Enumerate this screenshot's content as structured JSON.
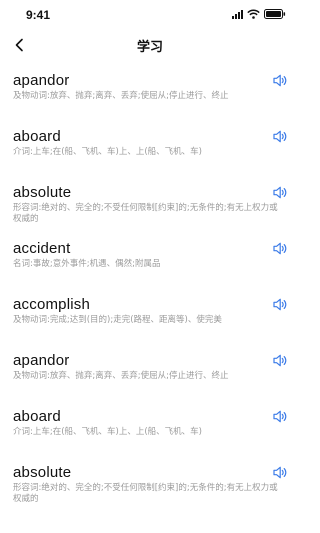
{
  "status_bar": {
    "time": "9:41"
  },
  "header": {
    "title": "学习"
  },
  "colors": {
    "accent": "#3b7be8",
    "definition": "#9b9b9b"
  },
  "words": [
    {
      "word": "apandor",
      "definition": "及物动词:放弃、抛弃;离弃、丢弃;使屈从;停止进行、终止"
    },
    {
      "word": "aboard",
      "definition": "介词:上车;在(船、飞机、车)上、上(船、飞机、车)"
    },
    {
      "word": "absolute",
      "definition": "形容词:绝对的、完全的;不受任何限制[约束]的;无条件的;有无上权力或权威的"
    },
    {
      "word": "accident",
      "definition": "名词:事故;意外事件;机遇、偶然;附属品"
    },
    {
      "word": "accomplish",
      "definition": "及物动词:完成;达到(目的);走完(路程、距离等)、使完美"
    },
    {
      "word": "apandor",
      "definition": "及物动词:放弃、抛弃;离弃、丢弃;使屈从;停止进行、终止"
    },
    {
      "word": "aboard",
      "definition": "介词:上车;在(船、飞机、车)上、上(船、飞机、车)"
    },
    {
      "word": "absolute",
      "definition": "形容词:绝对的、完全的;不受任何限制[约束]的;无条件的;有无上权力或权威的"
    }
  ]
}
